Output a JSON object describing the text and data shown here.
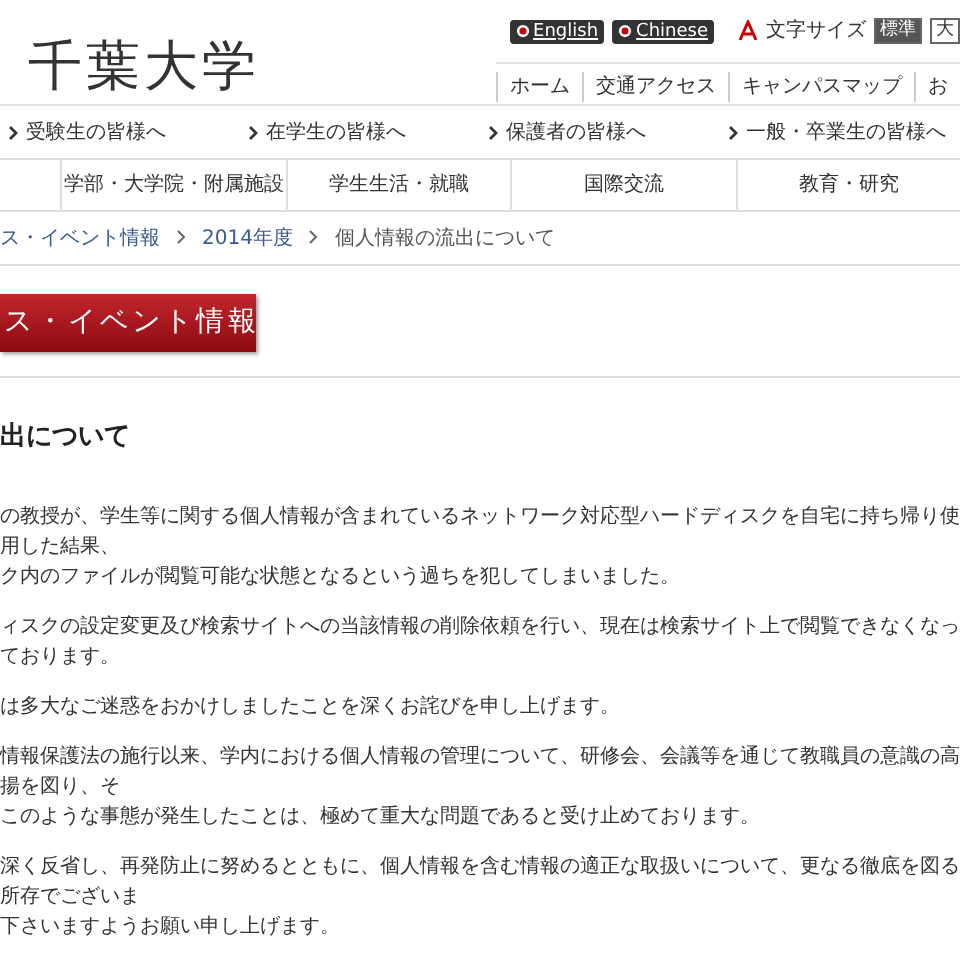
{
  "logo": "千葉大学",
  "language_buttons": [
    "English",
    "Chinese"
  ],
  "font_size": {
    "label": "文字サイズ",
    "options": [
      {
        "label": "標準",
        "selected": true
      },
      {
        "label": "大",
        "selected": false
      }
    ]
  },
  "utility_links": [
    "ホーム",
    "交通アクセス",
    "キャンパスマップ",
    "お"
  ],
  "audience_nav": [
    "受験生の皆様へ",
    "在学生の皆様へ",
    "保護者の皆様へ",
    "一般・卒業生の皆様へ"
  ],
  "main_nav": [
    "学部・大学院・附属施設",
    "学生生活・就職",
    "国際交流",
    "教育・研究"
  ],
  "breadcrumb": [
    {
      "label": "ス・イベント情報",
      "link": true
    },
    {
      "label": "2014年度",
      "link": true
    },
    {
      "label": "個人情報の流出について",
      "link": false
    }
  ],
  "section_banner": "ス・イベント情報",
  "article": {
    "title": "出について",
    "paragraphs": [
      [
        "の教授が、学生等に関する個人情報が含まれているネットワーク対応型ハードディスクを自宅に持ち帰り使用した結果、",
        "ク内のファイルが閲覧可能な状態となるという過ちを犯してしまいました。"
      ],
      [
        "ィスクの設定変更及び検索サイトへの当該情報の削除依頼を行い、現在は検索サイト上で閲覧できなくなっております。"
      ],
      [
        "は多大なご迷惑をおかけしましたことを深くお詫びを申し上げます。"
      ],
      [
        "情報保護法の施行以来、学内における個人情報の管理について、研修会、会議等を通じて教職員の意識の高揚を図り、そ",
        "このような事態が発生したことは、極めて重大な問題であると受け止めております。"
      ],
      [
        "深く反省し、再発防止に努めるとともに、個人情報を含む情報の適正な取扱いについて、更なる徹底を図る所存でございま",
        "下さいますようお願い申し上げます。"
      ]
    ]
  }
}
